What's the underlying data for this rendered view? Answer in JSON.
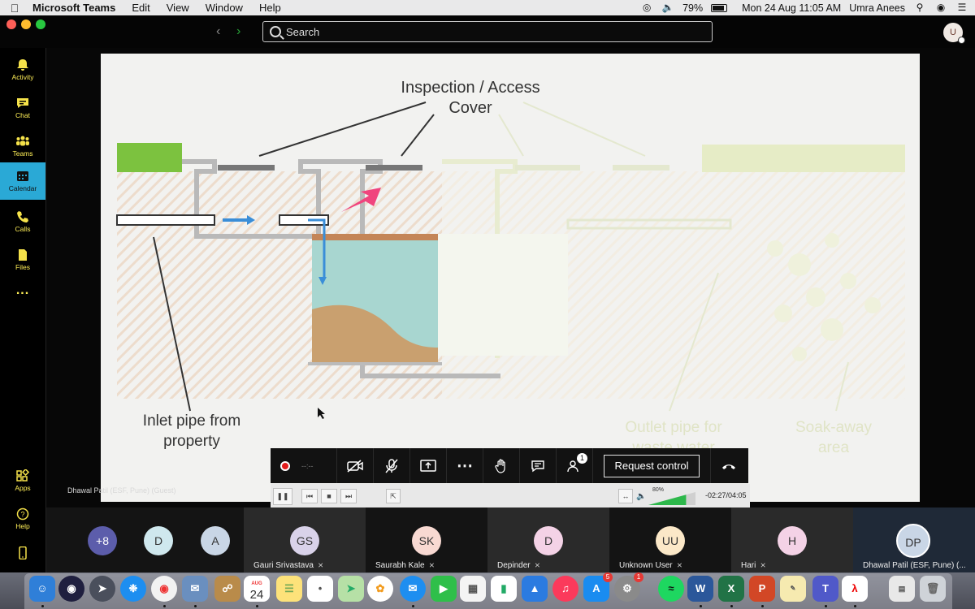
{
  "menubar": {
    "app_name": "Microsoft Teams",
    "menus": [
      "Edit",
      "View",
      "Window",
      "Help"
    ],
    "battery": "79%",
    "datetime": "Mon 24 Aug  11:05 AM",
    "user": "Umra Anees"
  },
  "titlebar": {
    "search_placeholder": "Search",
    "user_initial": "U"
  },
  "sidebar": {
    "items": [
      {
        "label": "Activity",
        "icon": "bell-icon"
      },
      {
        "label": "Chat",
        "icon": "chat-icon"
      },
      {
        "label": "Teams",
        "icon": "teams-icon"
      },
      {
        "label": "Calendar",
        "icon": "calendar-icon",
        "active": true
      },
      {
        "label": "Calls",
        "icon": "phone-icon"
      },
      {
        "label": "Files",
        "icon": "file-icon"
      },
      {
        "label": "...",
        "icon": "more-icon"
      },
      {
        "label": "Apps",
        "icon": "apps-icon"
      },
      {
        "label": "Help",
        "icon": "help-icon"
      }
    ],
    "accent": "#f5e24a",
    "active_bg": "#2aa9d6"
  },
  "slide": {
    "label_cover_1": "Inspection / Access",
    "label_cover_2": "Cover",
    "label_inlet_1": "Inlet pipe from",
    "label_inlet_2": "property",
    "label_outlet_1": "Outlet pipe for",
    "label_outlet_2": "waste water",
    "label_soak_1": "Soak-away",
    "label_soak_2": "area"
  },
  "presenter": "Dhawal Patil (ESF, Pune) (Guest)",
  "call_controls": {
    "timer": "--:--",
    "participants_badge": "1",
    "request_control": "Request control"
  },
  "media_bar": {
    "volume": "80%",
    "volume_fraction": 0.8,
    "time": "-02:27/04:05"
  },
  "participants": {
    "overflow": "+8",
    "tiles": [
      {
        "initials": "D",
        "color": "#cfe8ee",
        "name": ""
      },
      {
        "initials": "A",
        "color": "#c9d6e6",
        "name": ""
      },
      {
        "initials": "GS",
        "color": "#d9d2e9",
        "name": "Gauri Srivastava"
      },
      {
        "initials": "SK",
        "color": "#f8d9d2",
        "name": "Saurabh Kale"
      },
      {
        "initials": "D",
        "color": "#f4d2e6",
        "name": "Depinder"
      },
      {
        "initials": "UU",
        "color": "#fbe8c8",
        "name": "Unknown User"
      },
      {
        "initials": "H",
        "color": "#f4d2e6",
        "name": "Hari"
      },
      {
        "initials": "DP",
        "color": "#c9d6e6",
        "name": "Dhawal Patil (ESF, Pune) (..."
      }
    ]
  },
  "dock": {
    "calendar_day": "24",
    "calendar_month": "AUG",
    "appstore_badge": "5",
    "settings_badge": "1"
  }
}
